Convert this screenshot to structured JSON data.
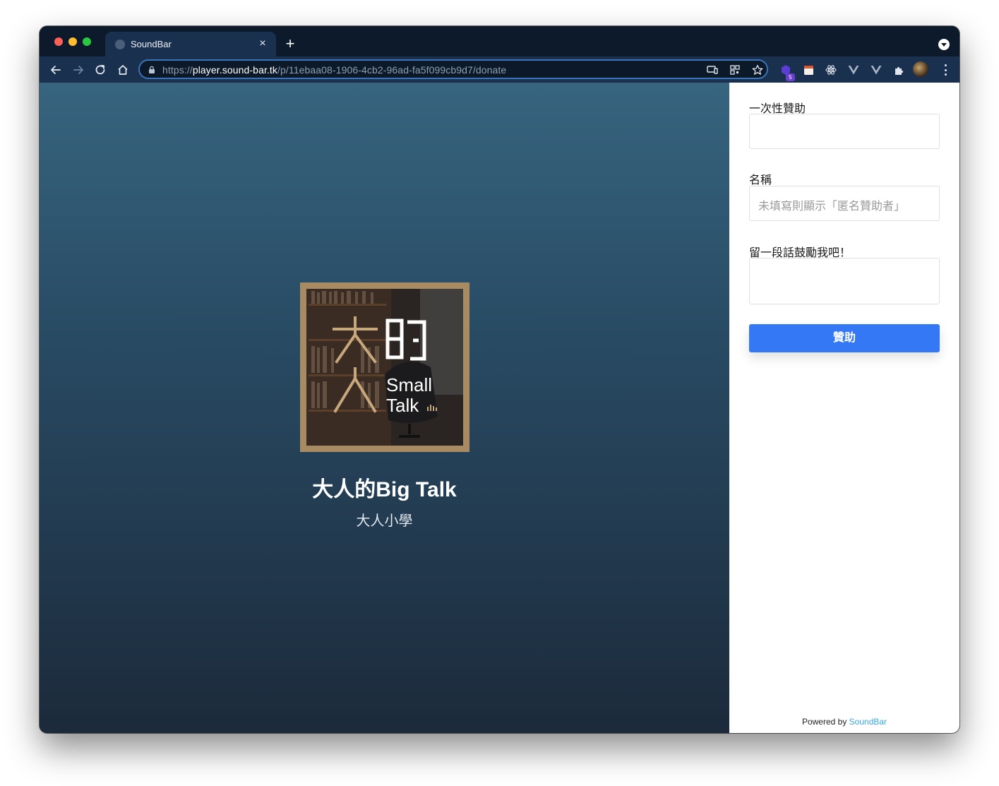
{
  "browser": {
    "tab_title": "SoundBar",
    "tab_close": "×",
    "new_tab": "+",
    "url_scheme": "https://",
    "url_host": "player.sound-bar.tk",
    "url_path": "/p/11ebaa08-1906-4cb2-96ad-fa5f099cb9d7/donate",
    "extension_badge": "5"
  },
  "hero": {
    "cover_text_big": "大人的",
    "cover_line1": "Small",
    "cover_line2": "Talk",
    "podcast_title": "大人的Big Talk",
    "podcast_author": "大人小學"
  },
  "form": {
    "amount_label": "一次性贊助",
    "amount_value": "",
    "name_label": "名稱",
    "name_placeholder": "未填寫則顯示「匿名贊助者」",
    "message_label": "留一段話鼓勵我吧！",
    "message_value": "",
    "submit_label": "贊助"
  },
  "footer": {
    "powered_prefix": "Powered by",
    "powered_brand": "SoundBar"
  },
  "colors": {
    "primary_button": "#3478f6",
    "brand_link": "#37a8e0",
    "cover_frame": "#a88a63"
  }
}
